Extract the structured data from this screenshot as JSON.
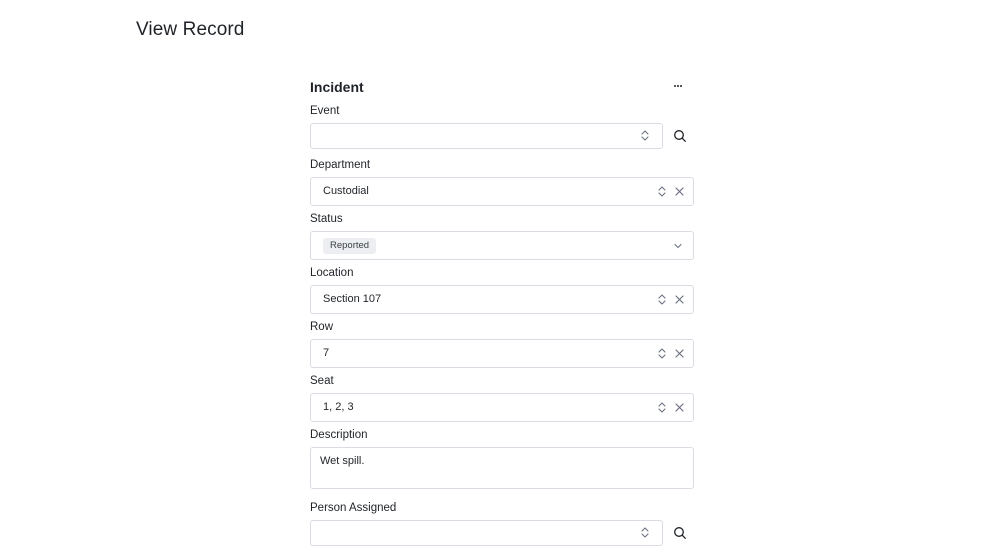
{
  "page": {
    "title": "View Record"
  },
  "form": {
    "title": "Incident",
    "more_icon": "ellipsis-icon",
    "fields": {
      "event": {
        "label": "Event",
        "value": ""
      },
      "department": {
        "label": "Department",
        "value": "Custodial"
      },
      "status": {
        "label": "Status",
        "value": "Reported"
      },
      "location": {
        "label": "Location",
        "value": "Section 107"
      },
      "row": {
        "label": "Row",
        "value": "7"
      },
      "seat": {
        "label": "Seat",
        "value": "1, 2, 3"
      },
      "description": {
        "label": "Description",
        "value": "Wet spill."
      },
      "person_assigned": {
        "label": "Person Assigned",
        "value": ""
      }
    }
  },
  "colors": {
    "border": "#d9dde3",
    "text": "#1f2328",
    "badge_bg": "#eceef1",
    "icon": "#6b7280"
  }
}
